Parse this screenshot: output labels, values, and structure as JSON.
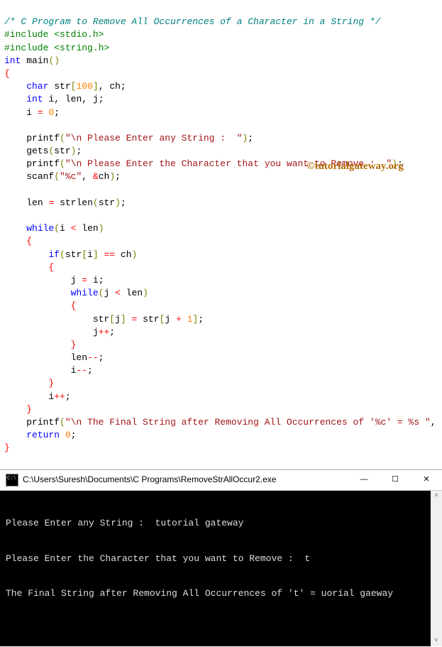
{
  "code": {
    "comment": "/* C Program to Remove All Occurrences of a Character in a String */",
    "include1": "#include",
    "header1": "<stdio.h>",
    "include2": "#include",
    "header2": "<string.h>",
    "kw_int": "int",
    "main": "main",
    "kw_char": "char",
    "var_str": "str",
    "size_100": "100",
    "var_ch": "ch",
    "var_i": "i",
    "var_len": "len",
    "var_j": "j",
    "zero": "0",
    "printf": "printf",
    "gets": "gets",
    "scanf": "scanf",
    "strlen": "strlen",
    "while": "while",
    "if": "if",
    "return": "return",
    "one": "1",
    "str_enter_string": "\"\\n Please Enter any String :  \"",
    "str_enter_char": "\"\\n Please Enter the Character that you want to Remove :  \"",
    "str_fmt_c": "\"%c\"",
    "str_final": "\"\\n The Final String after Removing All Occurrences of '%c' = %s \""
  },
  "watermark": "©tutorialgateway.org",
  "console": {
    "title": "C:\\Users\\Suresh\\Documents\\C Programs\\RemoveStrAllOccur2.exe",
    "line1": "Please Enter any String :  tutorial gateway",
    "line2": "Please Enter the Character that you want to Remove :  t",
    "line3": "The Final String after Removing All Occurrences of 't' = uorial gaeway"
  },
  "win": {
    "min": "—",
    "max": "☐",
    "close": "✕",
    "up": "˄",
    "down": "˅"
  }
}
